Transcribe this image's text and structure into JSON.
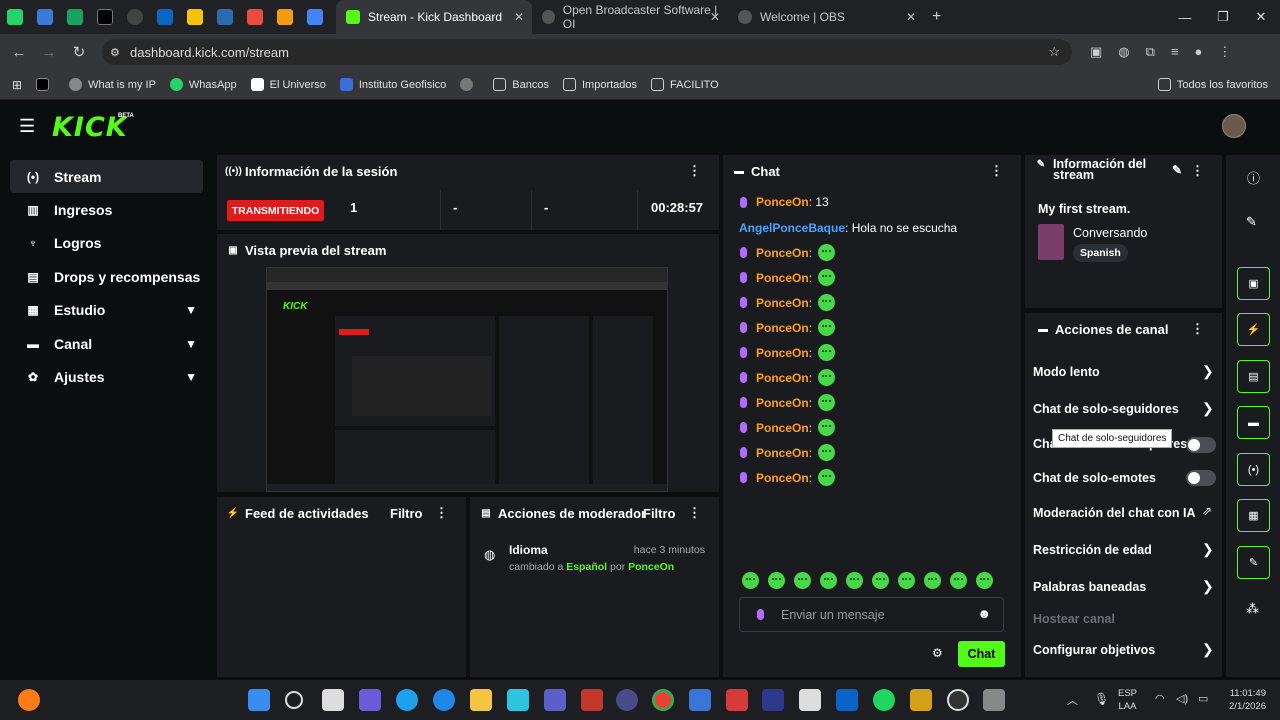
{
  "browser": {
    "tabs": [
      {
        "label": "Stream - Kick Dashboard",
        "active": true
      },
      {
        "label": "Open Broadcaster Software | OI",
        "active": false
      },
      {
        "label": "Welcome | OBS",
        "active": false
      }
    ],
    "url": "dashboard.kick.com/stream",
    "bookmarks": [
      "What is my IP",
      "WhasApp",
      "El Universo",
      "Instituto Geofisico",
      "Bancos",
      "Importados",
      "FACILITO"
    ],
    "bookmarks_all": "Todos los favoritos"
  },
  "app": {
    "logo": "KICK",
    "beta": "BETA"
  },
  "sidebar": {
    "items": [
      {
        "label": "Stream",
        "icon": "broadcast-icon"
      },
      {
        "label": "Ingresos",
        "icon": "bar-chart-icon"
      },
      {
        "label": "Logros",
        "icon": "trophy-icon"
      },
      {
        "label": "Drops y recompensas",
        "icon": "gift-icon"
      },
      {
        "label": "Estudio",
        "icon": "studio-icon"
      },
      {
        "label": "Canal",
        "icon": "user-icon"
      },
      {
        "label": "Ajustes",
        "icon": "gear-icon"
      }
    ]
  },
  "session": {
    "title": "Información de la sesión",
    "status": "TRANSMITIENDO",
    "viewers": "1",
    "s2": "-",
    "s3": "-",
    "time": "00:28:57"
  },
  "preview": {
    "title": "Vista previa del stream"
  },
  "feed": {
    "title": "Feed de actividades",
    "filter": "Filtro"
  },
  "mod": {
    "title": "Acciones de moderador",
    "filter": "Filtro",
    "event": {
      "type": "Idioma",
      "time": "hace 3 minutos",
      "pre": "cambiado a",
      "lang": "Español",
      "by": "por",
      "user": "PonceOn"
    }
  },
  "chat": {
    "title": "Chat",
    "messages": [
      {
        "user": "PonceOn",
        "text": "13",
        "color": "orange"
      },
      {
        "user": "AngelPonceBaque",
        "text": "Hola no se escucha",
        "color": "blue"
      },
      {
        "user": "PonceOn"
      },
      {
        "user": "PonceOn"
      },
      {
        "user": "PonceOn"
      },
      {
        "user": "PonceOn"
      },
      {
        "user": "PonceOn"
      },
      {
        "user": "PonceOn"
      },
      {
        "user": "PonceOn"
      },
      {
        "user": "PonceOn"
      },
      {
        "user": "PonceOn"
      },
      {
        "user": "PonceOn"
      }
    ],
    "placeholder": "Enviar un mensaje",
    "send": "Chat"
  },
  "streaminfo": {
    "title": "Información del stream",
    "name": "My first stream.",
    "category": "Conversando",
    "lang": "Spanish"
  },
  "actions": {
    "title": "Acciones de canal",
    "items": [
      "Modo lento",
      "Chat de solo-seguidores",
      "Chat de solo-suscriptores",
      "Chat de solo-emotes",
      "Moderación del chat con IA",
      "Restricción de edad",
      "Palabras baneadas",
      "Hostear canal",
      "Configurar objetivos"
    ],
    "tooltip": "Chat de solo-seguidores"
  },
  "taskbar": {
    "lang": "ESP",
    "layout": "LAA",
    "clock": "11:01:49",
    "date": "2/1/2026"
  }
}
